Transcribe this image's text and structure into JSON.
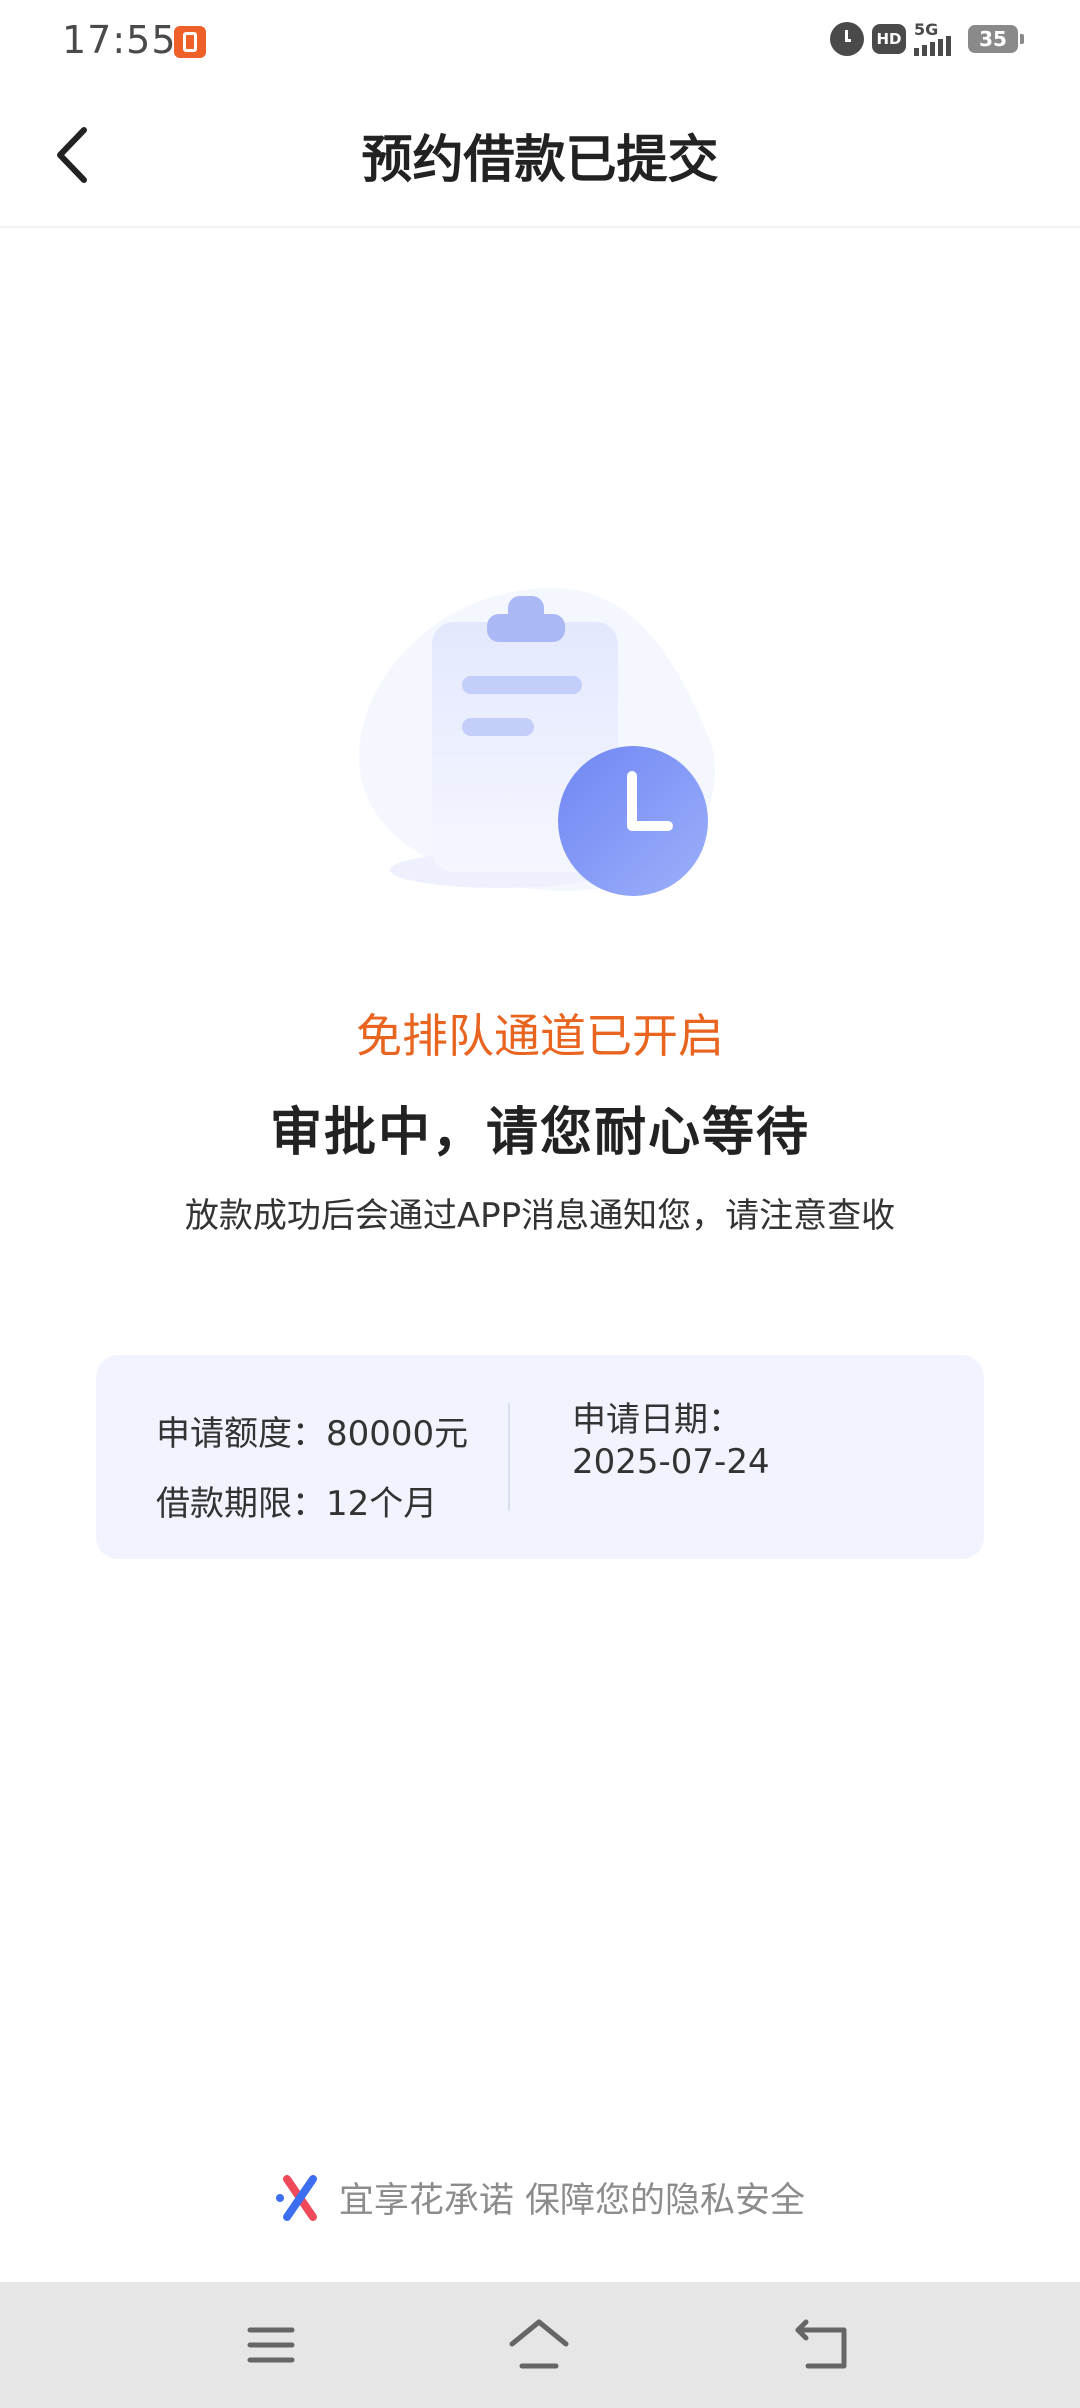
{
  "status_bar": {
    "time": "17:55",
    "network": "5G",
    "hd_label": "HD",
    "battery": "35"
  },
  "header": {
    "title": "预约借款已提交"
  },
  "main": {
    "tag": "免排队通道已开启",
    "headline": "审批中，请您耐心等待",
    "subtitle": "放款成功后会通过APP消息通知您，请注意查收"
  },
  "info_card": {
    "amount_label": "申请额度：",
    "amount_value": "80000元",
    "term_label": "借款期限：",
    "term_value": "12个月",
    "date_label": "申请日期：",
    "date_value": "2025-07-24"
  },
  "footer": {
    "brand_text": "宜享花承诺 保障您的隐私安全"
  },
  "colors": {
    "accent_orange": "#e8641f",
    "card_bg": "#f1f4fe",
    "clock_blue": "#7f96f5"
  },
  "icons": {
    "back": "chevron-left-icon",
    "illustration": "clipboard-clock-icon",
    "brand": "brand-x-logo-icon",
    "menu": "menu-icon",
    "home": "home-icon",
    "return": "return-icon"
  }
}
